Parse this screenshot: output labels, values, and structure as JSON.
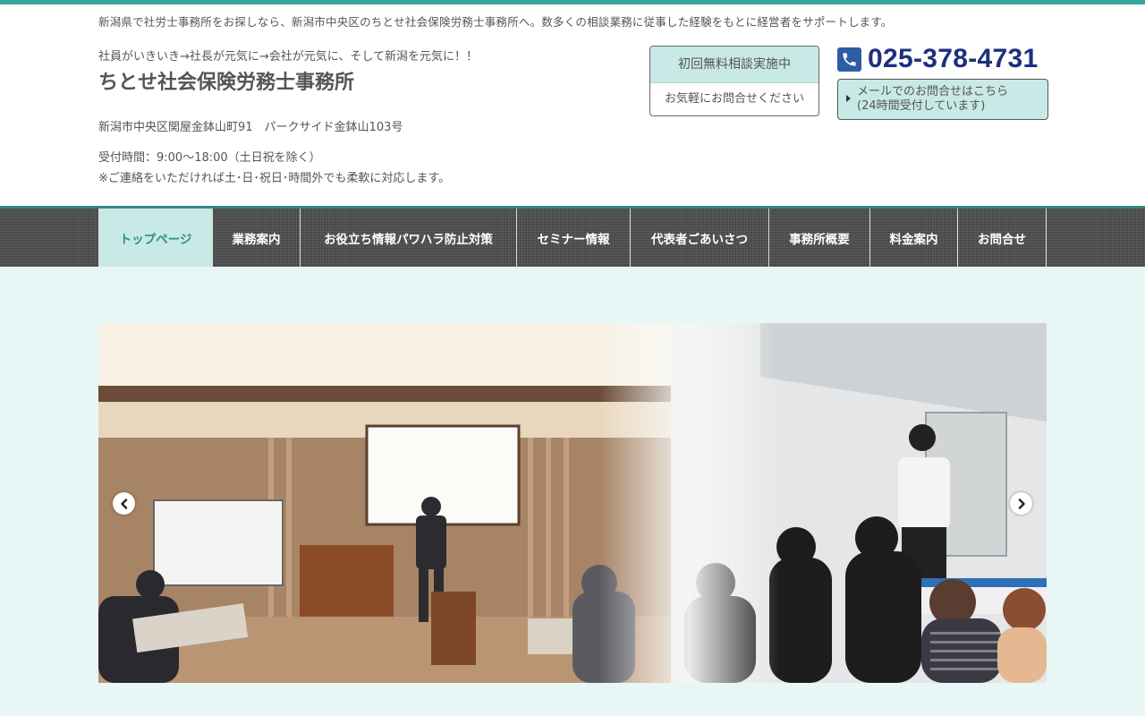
{
  "header": {
    "tagline": "新潟県で社労士事務所をお探しなら、新潟市中央区のちとせ社会保険労務士事務所へ。数多くの相談業務に従事した経験をもとに経営者をサポートします。",
    "catchphrase": "社員がいきいき→社長が元気に→会社が元気に、そして新潟を元気に！！",
    "site_title": "ちとせ社会保険労務士事務所",
    "address": "新潟市中央区関屋金鉢山町91　パークサイド金鉢山103号",
    "hours_line1": "受付時間：9:00～18:00（土日祝を除く）",
    "hours_line2": "※ご連絡をいただければ土･日･祝日･時間外でも柔軟に対応します。",
    "consult_title": "初回無料相談実施中",
    "consult_sub": "お気軽にお問合せください",
    "phone": "025-378-4731",
    "mail_line1": "メールでのお問合せはこちら",
    "mail_line2": "(24時間受付しています)"
  },
  "nav": {
    "items": [
      {
        "label": "トップページ",
        "active": true
      },
      {
        "label": "業務案内"
      },
      {
        "label": "お役立ち情報パワハラ防止対策"
      },
      {
        "label": "セミナー情報"
      },
      {
        "label": "代表者ごあいさつ"
      },
      {
        "label": "事務所概要"
      },
      {
        "label": "料金案内"
      },
      {
        "label": "お問合せ"
      }
    ]
  },
  "colors": {
    "accent": "#34a89a",
    "accent_light": "#c8e9e6",
    "phone_text": "#1d2f7e",
    "main_bg": "#e9f6f6"
  },
  "slider": {
    "prev_icon": "chevron-left-icon",
    "next_icon": "chevron-right-icon"
  }
}
